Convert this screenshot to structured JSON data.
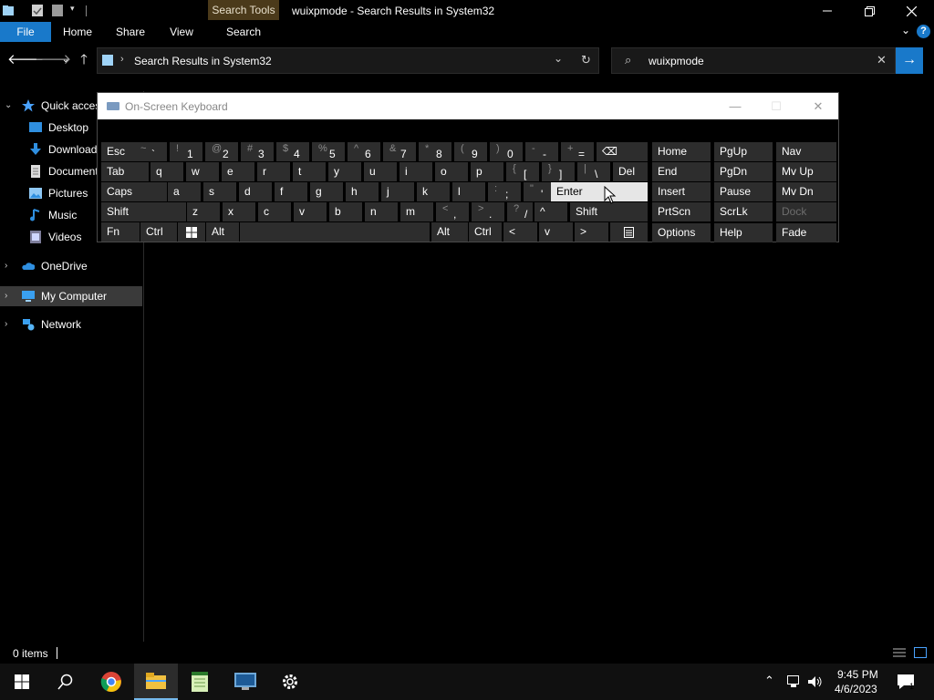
{
  "titlebar": {
    "context_tab": "Search Tools",
    "title": "wuixpmode - Search Results in System32"
  },
  "ribbon": {
    "tabs": [
      "File",
      "Home",
      "Share",
      "View",
      "Search"
    ],
    "help": "?"
  },
  "address": {
    "path": "Search Results in System32"
  },
  "search": {
    "query": "wuixpmode"
  },
  "navpane": {
    "items": [
      {
        "label": "Quick access"
      },
      {
        "label": "Desktop"
      },
      {
        "label": "Downloads"
      },
      {
        "label": "Documents"
      },
      {
        "label": "Pictures"
      },
      {
        "label": "Music"
      },
      {
        "label": "Videos"
      },
      {
        "label": "OneDrive"
      },
      {
        "label": "My Computer"
      },
      {
        "label": "Network"
      }
    ]
  },
  "status": {
    "items": "0 items"
  },
  "osk": {
    "title": "On-Screen Keyboard",
    "row1": [
      {
        "main": "Esc"
      },
      {
        "shift": "~",
        "main": "`"
      },
      {
        "shift": "!",
        "main": "1"
      },
      {
        "shift": "@",
        "main": "2"
      },
      {
        "shift": "#",
        "main": "3"
      },
      {
        "shift": "$",
        "main": "4"
      },
      {
        "shift": "%",
        "main": "5"
      },
      {
        "shift": "^",
        "main": "6"
      },
      {
        "shift": "&",
        "main": "7"
      },
      {
        "shift": "*",
        "main": "8"
      },
      {
        "shift": "(",
        "main": "9"
      },
      {
        "shift": ")",
        "main": "0"
      },
      {
        "shift": "-",
        "main": "-"
      },
      {
        "shift": "+",
        "main": "="
      },
      {
        "main": "⌫"
      }
    ],
    "row2": [
      {
        "main": "Tab"
      },
      {
        "main": "q"
      },
      {
        "main": "w"
      },
      {
        "main": "e"
      },
      {
        "main": "r"
      },
      {
        "main": "t"
      },
      {
        "main": "y"
      },
      {
        "main": "u"
      },
      {
        "main": "i"
      },
      {
        "main": "o"
      },
      {
        "main": "p"
      },
      {
        "shift": "{",
        "main": "["
      },
      {
        "shift": "}",
        "main": "]"
      },
      {
        "shift": "|",
        "main": "\\"
      },
      {
        "main": "Del"
      }
    ],
    "row3": [
      {
        "main": "Caps"
      },
      {
        "main": "a"
      },
      {
        "main": "s"
      },
      {
        "main": "d"
      },
      {
        "main": "f"
      },
      {
        "main": "g"
      },
      {
        "main": "h"
      },
      {
        "main": "j"
      },
      {
        "main": "k"
      },
      {
        "main": "l"
      },
      {
        "shift": ":",
        "main": ";"
      },
      {
        "shift": "\"",
        "main": "'"
      },
      {
        "main": "Enter"
      }
    ],
    "row4": [
      {
        "main": "Shift"
      },
      {
        "main": "z"
      },
      {
        "main": "x"
      },
      {
        "main": "c"
      },
      {
        "main": "v"
      },
      {
        "main": "b"
      },
      {
        "main": "n"
      },
      {
        "main": "m"
      },
      {
        "shift": "<",
        "main": ","
      },
      {
        "shift": ">",
        "main": "."
      },
      {
        "shift": "?",
        "main": "/"
      },
      {
        "main": "^"
      },
      {
        "main": "Shift"
      }
    ],
    "row5": [
      {
        "main": "Fn"
      },
      {
        "main": "Ctrl"
      },
      {
        "main": ""
      },
      {
        "main": "Alt"
      },
      {
        "main": ""
      },
      {
        "main": "Alt"
      },
      {
        "main": "Ctrl"
      },
      {
        "main": "<"
      },
      {
        "main": "v"
      },
      {
        "main": ">"
      },
      {
        "main": ""
      }
    ],
    "nav_keys": [
      [
        "Home",
        "PgUp",
        "Nav"
      ],
      [
        "End",
        "PgDn",
        "Mv Up"
      ],
      [
        "Insert",
        "Pause",
        "Mv Dn"
      ],
      [
        "PrtScn",
        "ScrLk",
        "Dock"
      ],
      [
        "Options",
        "Help",
        "Fade"
      ]
    ]
  },
  "clock": {
    "time": "9:45 PM",
    "date": "4/6/2023"
  },
  "colors": {
    "accent": "#1979ca",
    "context_tab": "#4b3a1a",
    "key": "#2d2d2d",
    "key_hover": "#e6e6e6"
  }
}
